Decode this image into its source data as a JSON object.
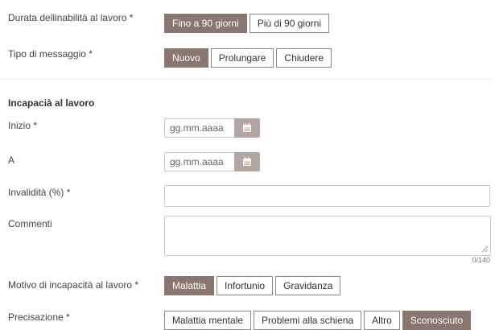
{
  "labels": {
    "durata": "Durata dellinabilità al lavoro *",
    "tipo": "Tipo di messaggio *",
    "section_title": "Incapacià al lavoro",
    "inizio": "Inizio *",
    "a": "A",
    "invalidita": "Invalidità (%) *",
    "commenti": "Commenti",
    "motivo": "Motivo di incapacità al lavoro *",
    "precisazione": "Precisazione *"
  },
  "durata_options": [
    {
      "label": "Fino a 90 giorni",
      "selected": true
    },
    {
      "label": "Più di 90 giorni",
      "selected": false
    }
  ],
  "tipo_options": [
    {
      "label": "Nuovo",
      "selected": true
    },
    {
      "label": "Prolungare",
      "selected": false
    },
    {
      "label": "Chiudere",
      "selected": false
    }
  ],
  "inizio_field": {
    "placeholder": "gg.mm.aaaa",
    "value": ""
  },
  "a_field": {
    "placeholder": "gg.mm.aaaa",
    "value": ""
  },
  "invalidita_field": {
    "value": ""
  },
  "commenti_field": {
    "value": "",
    "counter": "0/140"
  },
  "motivo_options": [
    {
      "label": "Malattia",
      "selected": true
    },
    {
      "label": "Infortunio",
      "selected": false
    },
    {
      "label": "Gravidanza",
      "selected": false
    }
  ],
  "precisazione_options": [
    {
      "label": "Malattia mentale",
      "selected": false
    },
    {
      "label": "Problemi alla schiena",
      "selected": false
    },
    {
      "label": "Altro",
      "selected": false
    },
    {
      "label": "Sconosciuto",
      "selected": true
    }
  ],
  "icons": {
    "date_picker": "calendar-icon"
  },
  "colors": {
    "accent": "#8a7670",
    "calendar_button": "#b3a6a0",
    "border": "#8a8a8a"
  }
}
